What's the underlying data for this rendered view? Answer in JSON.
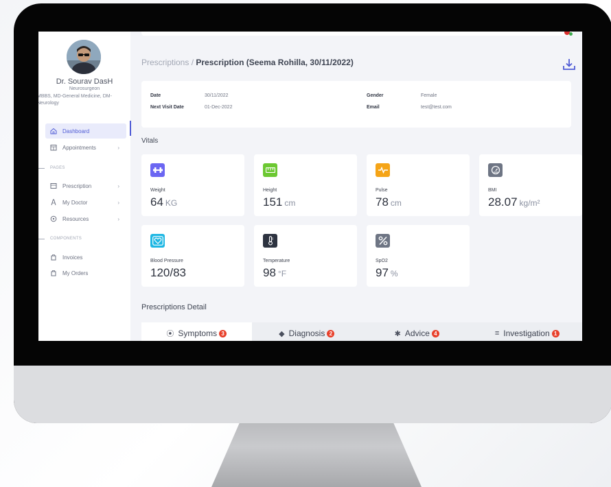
{
  "doctor": {
    "name": "Dr. Sourav DasH",
    "specialty": "Neurosurgeon",
    "degrees": "MBBS, MD-General Medicine, DM- Neurology"
  },
  "sidebar": {
    "items": [
      {
        "label": "Dashboard",
        "icon": "home-icon",
        "active": true
      },
      {
        "label": "Appointments",
        "icon": "calendar-icon"
      }
    ],
    "section_pages": "PAGES",
    "pages": [
      {
        "label": "Prescription",
        "icon": "prescription-icon"
      },
      {
        "label": "My Doctor",
        "icon": "doctor-icon"
      },
      {
        "label": "Resources",
        "icon": "resources-icon"
      }
    ],
    "section_components": "COMPONENTS",
    "components": [
      {
        "label": "Invoices",
        "icon": "invoice-icon"
      },
      {
        "label": "My Orders",
        "icon": "orders-icon"
      }
    ]
  },
  "breadcrumb": {
    "parent": "Prescriptions /",
    "current": "Prescription (Seema Rohilla, 30/11/2022)"
  },
  "info": {
    "date_label": "Date",
    "date_value": "30/11/2022",
    "next_visit_label": "Next Visit Date",
    "next_visit_value": "01-Dec-2022",
    "gender_label": "Gender",
    "gender_value": "Female",
    "email_label": "Email",
    "email_value": "test@test.com"
  },
  "vitals_title": "Vitals",
  "vitals": [
    {
      "label": "Weight",
      "value": "64",
      "unit": "KG",
      "icon": "dumbbell-icon",
      "color": "#6b66f2"
    },
    {
      "label": "Height",
      "value": "151",
      "unit": "cm",
      "icon": "ruler-icon",
      "color": "#6cc832"
    },
    {
      "label": "Pulse",
      "value": "78",
      "unit": "cm",
      "icon": "pulse-icon",
      "color": "#f5a417"
    },
    {
      "label": "BMI",
      "value": "28.07",
      "unit": "kg/m²",
      "icon": "gauge-icon",
      "color": "#6e7584"
    },
    {
      "label": "Blood Pressure",
      "value": "120/83",
      "unit": "",
      "icon": "heart-icon",
      "color": "#1fb7e3"
    },
    {
      "label": "Temperature",
      "value": "98",
      "unit": "°F",
      "icon": "thermometer-icon",
      "color": "#2d3340"
    },
    {
      "label": "SpO2",
      "value": "97",
      "unit": "%",
      "icon": "percent-icon",
      "color": "#6e7584"
    }
  ],
  "details_title": "Prescriptions Detail",
  "tabs": [
    {
      "label": "Symptoms",
      "count": "3",
      "icon": "symptoms-icon",
      "glyph": "⦿"
    },
    {
      "label": "Diagnosis",
      "count": "2",
      "icon": "diagnosis-icon",
      "glyph": "◆"
    },
    {
      "label": "Advice",
      "count": "4",
      "icon": "advice-icon",
      "glyph": "✱"
    },
    {
      "label": "Investigation",
      "count": "1",
      "icon": "investigation-icon",
      "glyph": "≡"
    }
  ]
}
